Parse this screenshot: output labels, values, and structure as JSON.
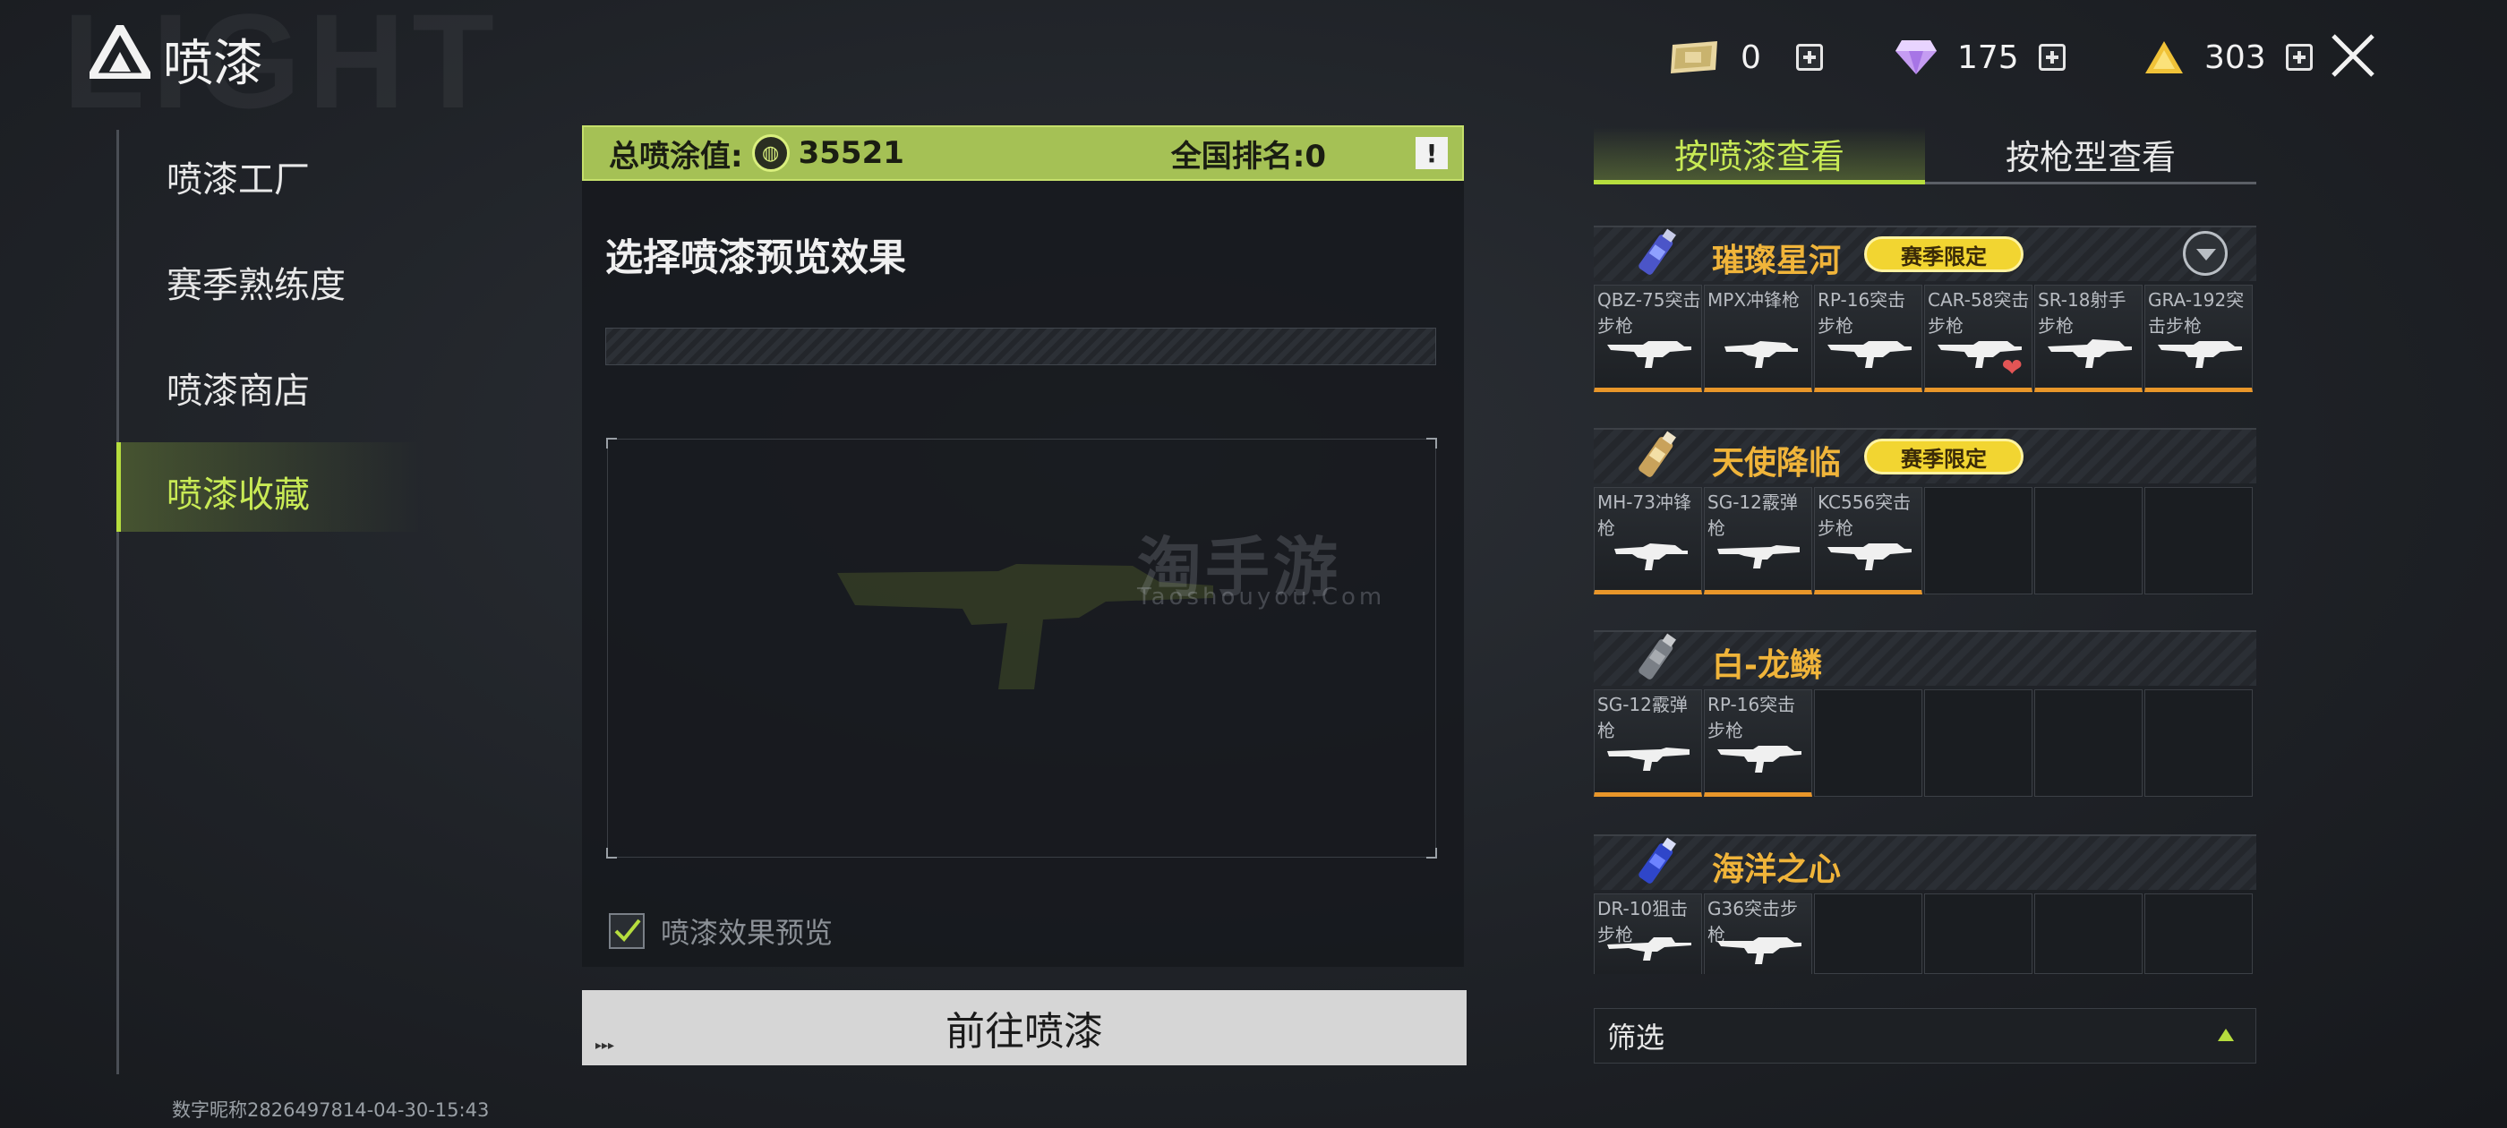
{
  "header": {
    "title": "喷漆",
    "bg_word": "LIGHT",
    "currencies": [
      {
        "name": "ticket-icon",
        "value": "0"
      },
      {
        "name": "diamond-icon",
        "value": "175"
      },
      {
        "name": "triangle-coin-icon",
        "value": "303"
      }
    ]
  },
  "nav": {
    "items": [
      "喷漆工厂",
      "赛季熟练度",
      "喷漆商店",
      "喷漆收藏"
    ],
    "active_index": 3
  },
  "footer": {
    "text": "数字昵称2826497814-04-30-15:43"
  },
  "center": {
    "total_label": "总喷涂值:",
    "total_value": "35521",
    "rank_label": "全国排名:0",
    "info_symbol": "!",
    "preview_title": "选择喷漆预览效果",
    "watermark": "淘手游",
    "watermark_sub": "Taoshouyou.Com",
    "preview_checkbox_label": "喷漆效果预览",
    "preview_checked": true,
    "go_button": "前往喷漆",
    "go_button_mark": "▸▸▸"
  },
  "right": {
    "tabs": [
      "按喷漆查看",
      "按枪型查看"
    ],
    "active_tab": 0,
    "groups": [
      {
        "name": "璀璨星河",
        "badge": "赛季限定",
        "icon_color": "#5c6bd6",
        "weapons": [
          "QBZ-75突击步枪",
          "MPX冲锋枪",
          "RP-16突击步枪",
          "CAR-58突击步枪",
          "SR-18射手步枪",
          "GRA-192突击步枪"
        ],
        "favorite_index": 3
      },
      {
        "name": "天使降临",
        "badge": "赛季限定",
        "icon_color": "#d6b067",
        "weapons": [
          "MH-73冲锋枪",
          "SG-12霰弹枪",
          "KC556突击步枪"
        ]
      },
      {
        "name": "白-龙鳞",
        "badge": "",
        "icon_color": "#9aa0a6",
        "weapons": [
          "SG-12霰弹枪",
          "RP-16突击步枪"
        ]
      },
      {
        "name": "海洋之心",
        "badge": "",
        "icon_color": "#3e57d8",
        "weapons": [
          "DR-10狙击步枪",
          "G36突击步枪"
        ]
      }
    ],
    "filter_label": "筛选"
  },
  "colors": {
    "accent_green": "#b6dd3e",
    "score_bar": "#a5c155",
    "group_name": "#f0b43a",
    "badge_yellow": "#f2d531",
    "card_underline": "#e8962a"
  }
}
